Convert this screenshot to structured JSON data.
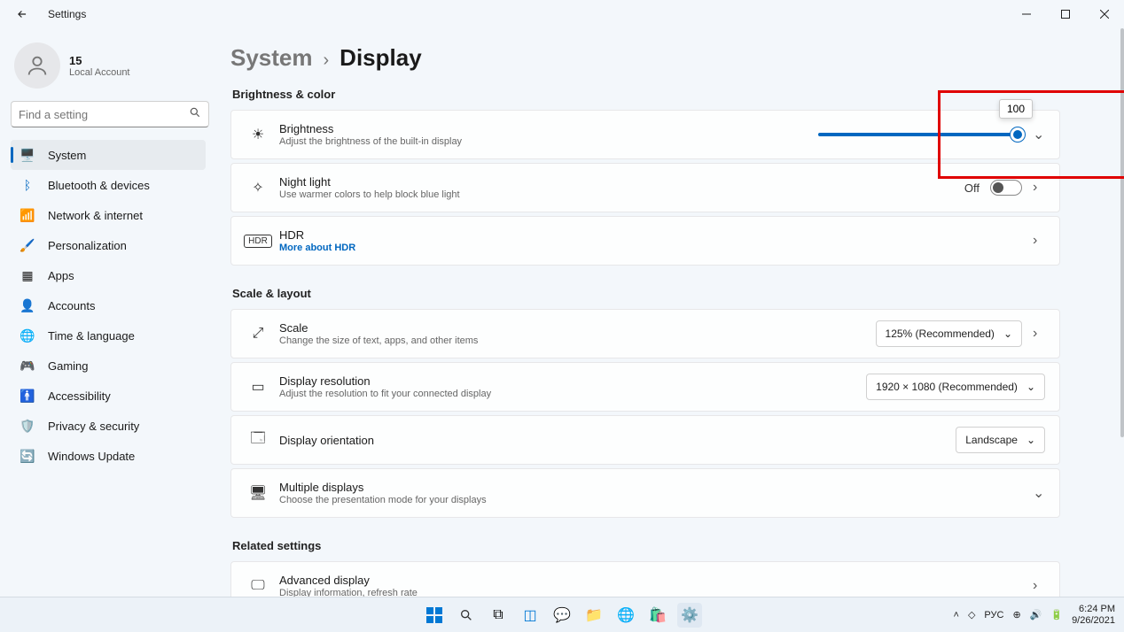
{
  "window": {
    "title": "Settings"
  },
  "account": {
    "name": "15",
    "sub": "Local Account"
  },
  "search": {
    "placeholder": "Find a setting"
  },
  "nav": {
    "system": "System",
    "bluetooth": "Bluetooth & devices",
    "network": "Network & internet",
    "personalization": "Personalization",
    "apps": "Apps",
    "accounts": "Accounts",
    "timelang": "Time & language",
    "gaming": "Gaming",
    "accessibility": "Accessibility",
    "privacy": "Privacy & security",
    "update": "Windows Update"
  },
  "breadcrumb": {
    "parent": "System",
    "current": "Display"
  },
  "sections": {
    "brightness_color": "Brightness & color",
    "scale_layout": "Scale & layout",
    "related": "Related settings"
  },
  "brightness": {
    "title": "Brightness",
    "sub": "Adjust the brightness of the built-in display",
    "value": "100"
  },
  "nightlight": {
    "title": "Night light",
    "sub": "Use warmer colors to help block blue light",
    "state": "Off"
  },
  "hdr": {
    "title": "HDR",
    "link": "More about HDR"
  },
  "scale": {
    "title": "Scale",
    "sub": "Change the size of text, apps, and other items",
    "value": "125% (Recommended)"
  },
  "resolution": {
    "title": "Display resolution",
    "sub": "Adjust the resolution to fit your connected display",
    "value": "1920 × 1080 (Recommended)"
  },
  "orientation": {
    "title": "Display orientation",
    "value": "Landscape"
  },
  "multi": {
    "title": "Multiple displays",
    "sub": "Choose the presentation mode for your displays"
  },
  "advanced": {
    "title": "Advanced display",
    "sub": "Display information, refresh rate"
  },
  "taskbar": {
    "lang": "РУС",
    "time": "6:24 PM",
    "date": "9/26/2021"
  }
}
